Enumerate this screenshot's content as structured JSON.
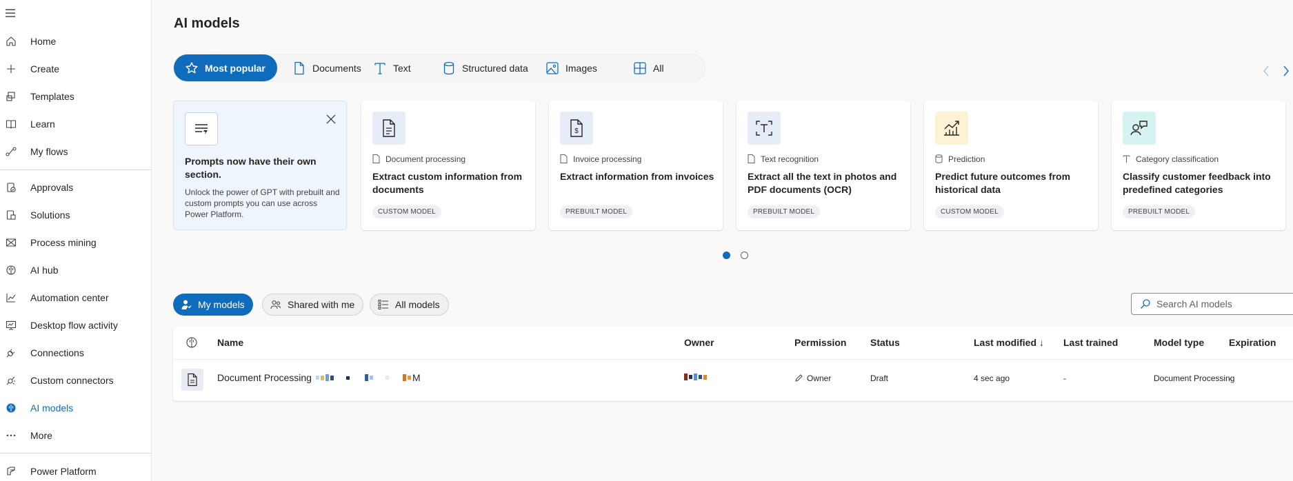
{
  "sidebar": {
    "items": [
      {
        "label": "Home",
        "icon": "home-icon"
      },
      {
        "label": "Create",
        "icon": "plus-icon"
      },
      {
        "label": "Templates",
        "icon": "templates-icon"
      },
      {
        "label": "Learn",
        "icon": "book-icon"
      },
      {
        "label": "My flows",
        "icon": "flow-icon"
      },
      {
        "label": "Approvals",
        "icon": "approvals-icon"
      },
      {
        "label": "Solutions",
        "icon": "solutions-icon"
      },
      {
        "label": "Process mining",
        "icon": "process-mining-icon"
      },
      {
        "label": "AI hub",
        "icon": "brain-icon"
      },
      {
        "label": "Automation center",
        "icon": "chart-icon"
      },
      {
        "label": "Desktop flow activity",
        "icon": "desktop-icon"
      },
      {
        "label": "Connections",
        "icon": "plug-icon"
      },
      {
        "label": "Custom connectors",
        "icon": "connector-icon"
      },
      {
        "label": "AI models",
        "icon": "ai-models-icon"
      },
      {
        "label": "More",
        "icon": "more-icon"
      },
      {
        "label": "Power Platform",
        "icon": "power-platform-icon"
      }
    ]
  },
  "page": {
    "title": "AI models"
  },
  "category_tabs": [
    {
      "label": "Most popular",
      "icon": "star-icon"
    },
    {
      "label": "Documents",
      "icon": "document-icon"
    },
    {
      "label": "Text",
      "icon": "text-icon"
    },
    {
      "label": "Structured data",
      "icon": "database-icon"
    },
    {
      "label": "Images",
      "icon": "image-icon"
    },
    {
      "label": "All",
      "icon": "grid-icon"
    }
  ],
  "promo": {
    "title": "Prompts now have their own section.",
    "description": "Unlock the power of GPT with prebuilt and custom prompts you can use across Power Platform."
  },
  "cards": [
    {
      "category": "Document processing",
      "title": "Extract custom information from documents",
      "badge": "CUSTOM MODEL",
      "icon": "document-processing-icon"
    },
    {
      "category": "Invoice processing",
      "title": "Extract information from invoices",
      "badge": "PREBUILT MODEL",
      "icon": "invoice-icon"
    },
    {
      "category": "Text recognition",
      "title": "Extract all the text in photos and PDF documents (OCR)",
      "badge": "PREBUILT MODEL",
      "icon": "text-recognition-icon"
    },
    {
      "category": "Prediction",
      "title": "Predict future outcomes from historical data",
      "badge": "CUSTOM MODEL",
      "icon": "prediction-icon"
    },
    {
      "category": "Category classification",
      "title": "Classify customer feedback into predefined categories",
      "badge": "PREBUILT MODEL",
      "icon": "classification-icon"
    }
  ],
  "filters": [
    {
      "label": "My models",
      "icon": "person-icon"
    },
    {
      "label": "Shared with me",
      "icon": "people-icon"
    },
    {
      "label": "All models",
      "icon": "list-icon"
    }
  ],
  "search": {
    "placeholder": "Search AI models"
  },
  "table": {
    "columns": [
      "Name",
      "Owner",
      "Permission",
      "Status",
      "Last modified ↓",
      "Last trained",
      "Model type",
      "Expiration"
    ],
    "rows": [
      {
        "name": "Document Processing",
        "name_suffix": "M",
        "permission": "Owner",
        "status": "Draft",
        "last_modified": "4 sec ago",
        "last_trained": "-",
        "model_type": "Document Processing",
        "expiration": "-"
      }
    ]
  },
  "colors": {
    "accent": "#0f6cbd"
  }
}
